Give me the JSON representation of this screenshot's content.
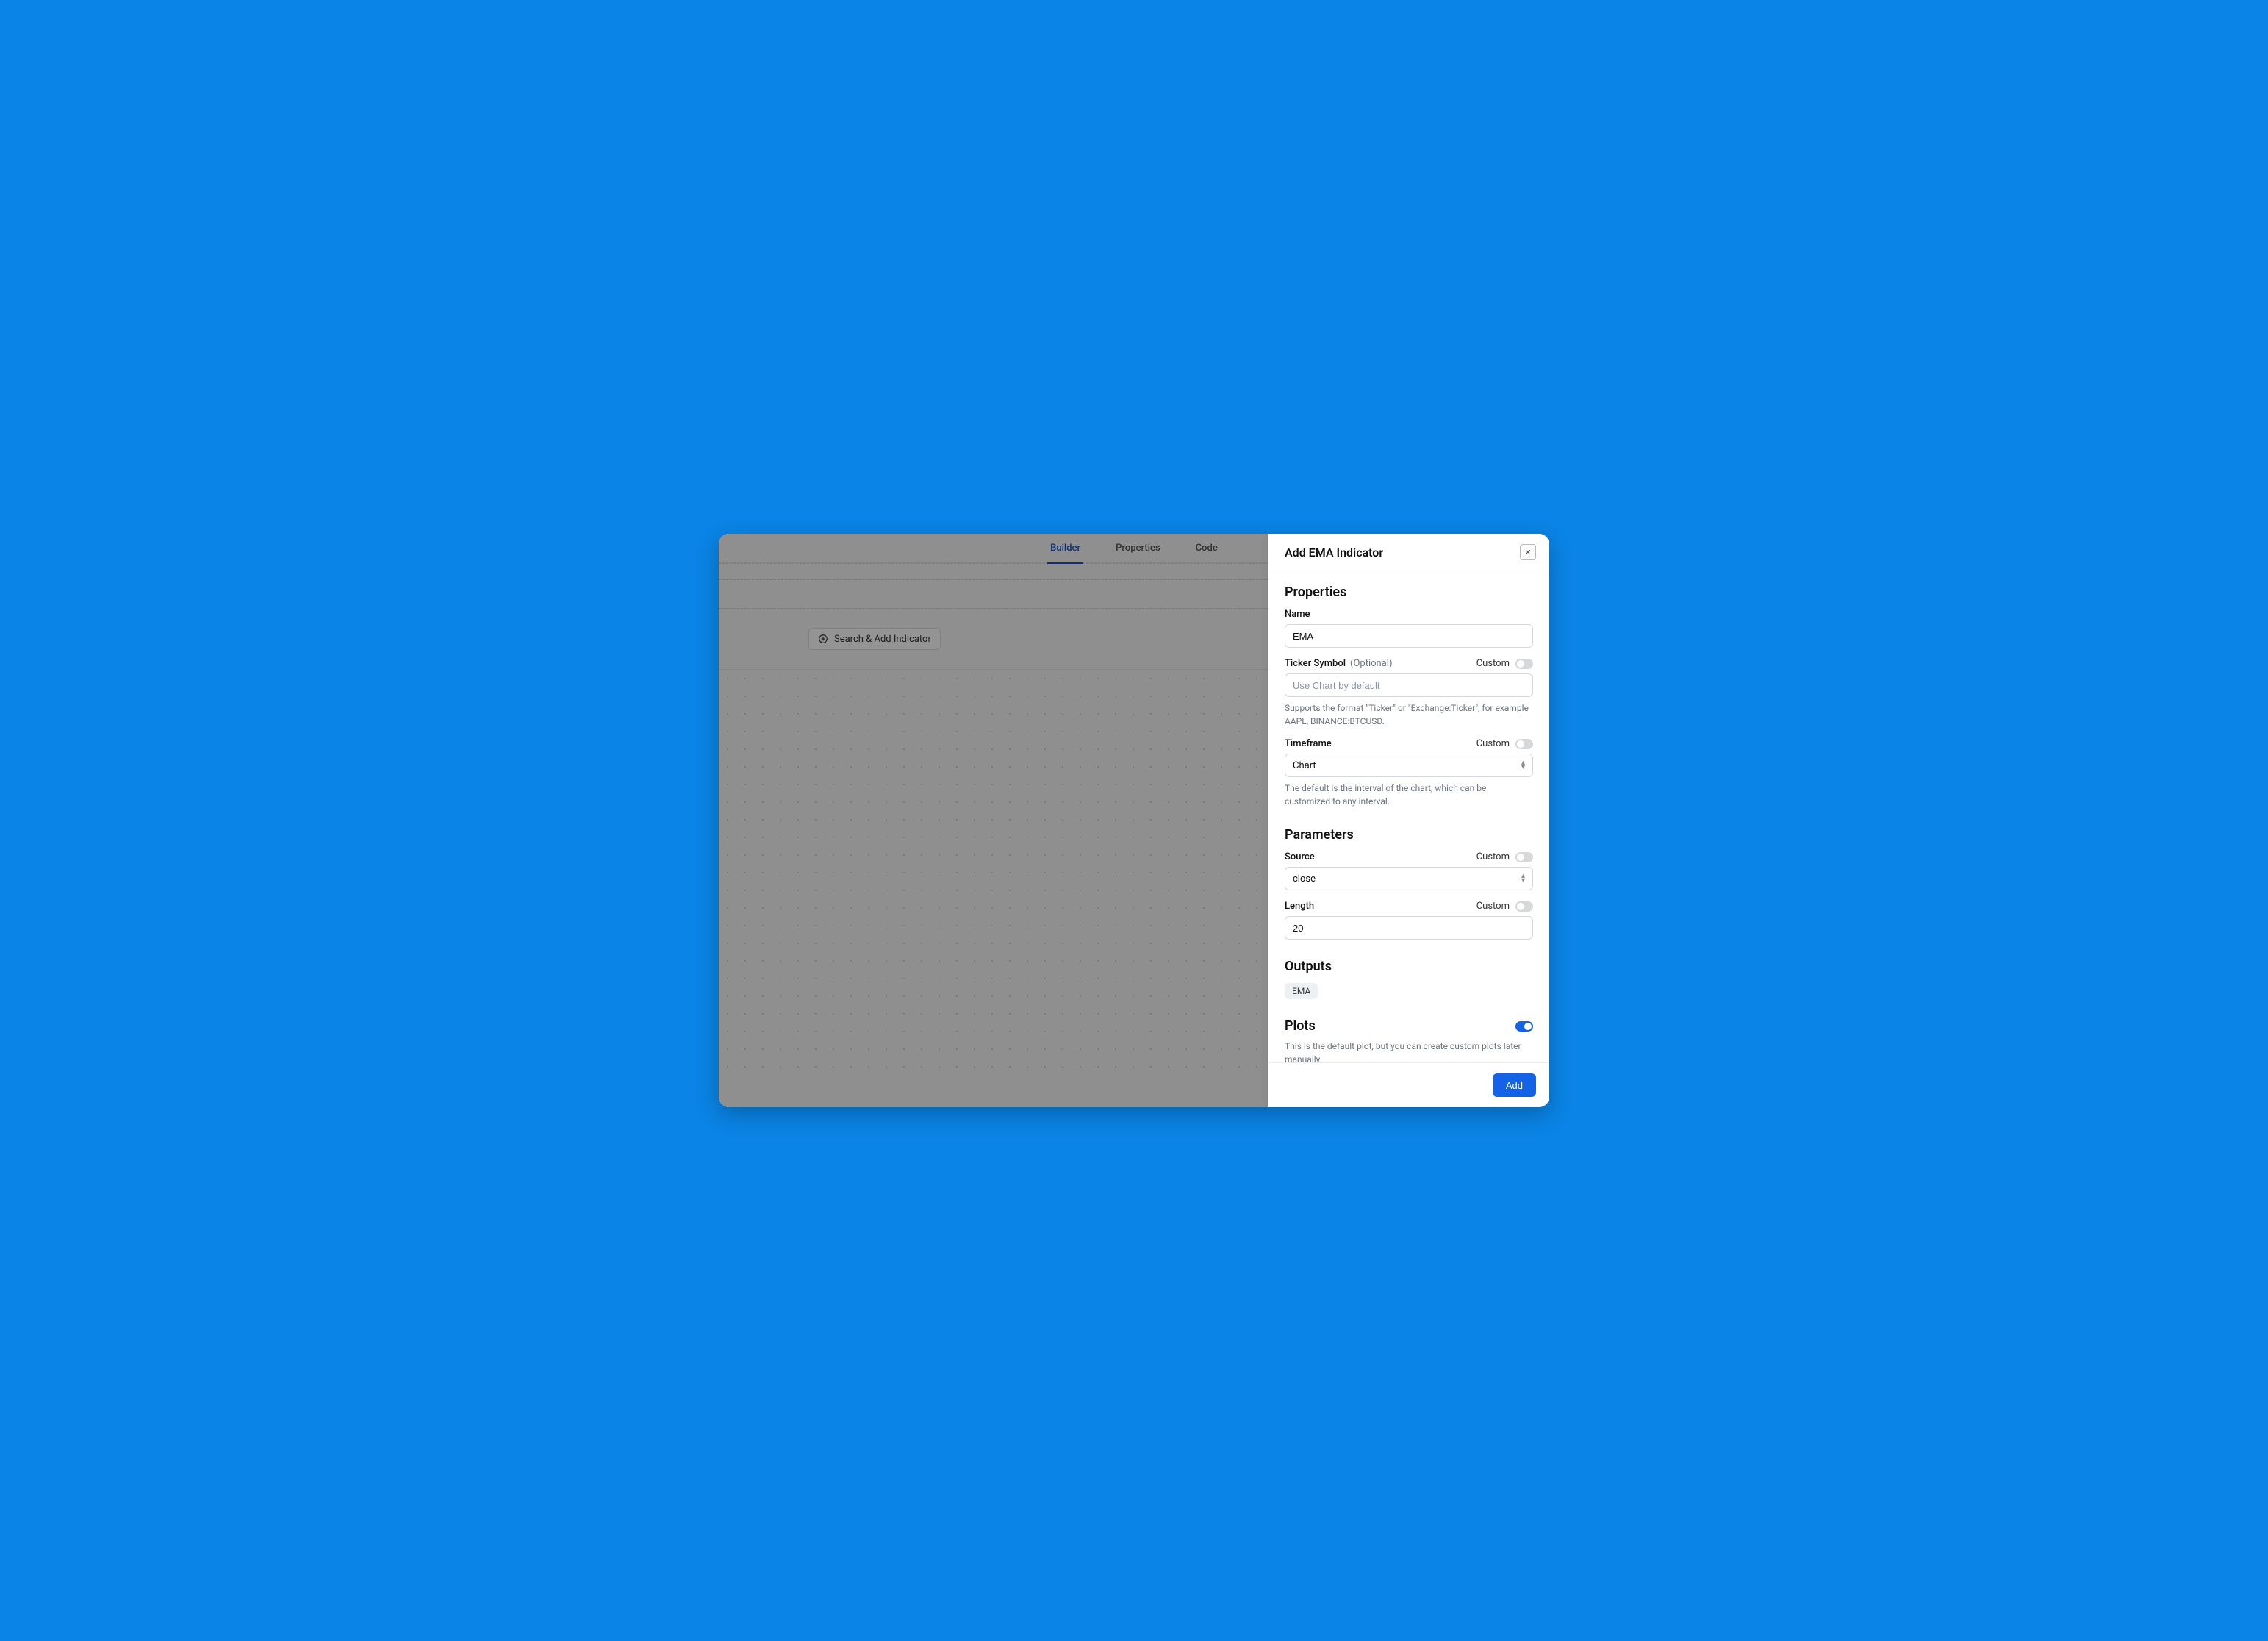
{
  "tabs": {
    "builder": "Builder",
    "properties": "Properties",
    "code": "Code"
  },
  "search_pill": "Search & Add Indicator",
  "panel": {
    "title": "Add EMA Indicator",
    "sections": {
      "properties": "Properties",
      "parameters": "Parameters",
      "outputs": "Outputs",
      "plots": "Plots"
    },
    "custom_label": "Custom",
    "name": {
      "label": "Name",
      "value": "EMA"
    },
    "ticker": {
      "label": "Ticker Symbol",
      "optional": "(Optional)",
      "placeholder": "Use Chart by default",
      "helper": "Supports the format \"Ticker\" or \"Exchange:Ticker\", for example AAPL, BINANCE:BTCUSD."
    },
    "timeframe": {
      "label": "Timeframe",
      "value": "Chart",
      "helper": "The default is the interval of the chart, which can be customized to any interval."
    },
    "source": {
      "label": "Source",
      "value": "close"
    },
    "length": {
      "label": "Length",
      "value": "20"
    },
    "outputs": [
      "EMA"
    ],
    "plots_helper": "This is the default plot, but you can create custom plots later manually.",
    "add_button": "Add"
  }
}
